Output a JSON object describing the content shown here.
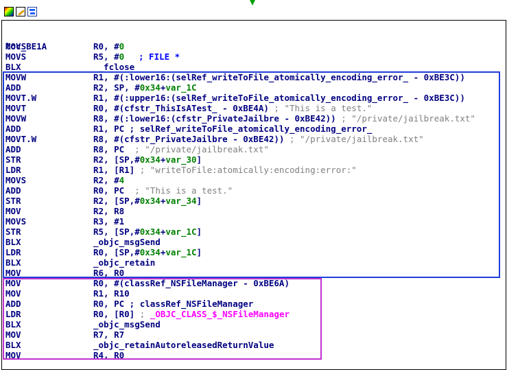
{
  "toolbar": {
    "icons": [
      "color-palette-icon",
      "edit-icon",
      "graph-view-icon"
    ]
  },
  "block": {
    "label": "loc_BE1A",
    "label_comment": "; FILE *"
  },
  "lines": [
    {
      "mnemonic": "MOVS",
      "ops": [
        {
          "t": "R0, #"
        },
        {
          "t": "0",
          "c": "grn"
        }
      ]
    },
    {
      "mnemonic": "MOVS",
      "ops": [
        {
          "t": "R5, #"
        },
        {
          "t": "0",
          "c": "grn"
        }
      ]
    },
    {
      "mnemonic": "BLX",
      "ops": [
        {
          "t": " _fclose"
        }
      ]
    },
    {
      "mnemonic": "MOVW",
      "ops": [
        {
          "t": "R1, #(:lower16:(selRef_writeToFile_atomically_encoding_error_ - 0xBE3C))"
        }
      ]
    },
    {
      "mnemonic": "ADD",
      "ops": [
        {
          "t": "R2, SP, #"
        },
        {
          "t": "0x34",
          "c": "grn"
        },
        {
          "t": "+"
        },
        {
          "t": "var_1C",
          "c": "grn"
        }
      ]
    },
    {
      "mnemonic": "MOVT.W",
      "ops": [
        {
          "t": "R1, #(:upper16:(selRef_writeToFile_atomically_encoding_error_ - 0xBE3C))"
        }
      ]
    },
    {
      "mnemonic": "MOVT",
      "ops": [
        {
          "t": "R0, #(cfstr_ThisIsATest_ - 0xBE4A) "
        },
        {
          "t": "; \"This is a test.\"",
          "c": "gry"
        }
      ]
    },
    {
      "mnemonic": "MOVW",
      "ops": [
        {
          "t": "R8, #(:lower16:(cfstr_PrivateJailbre - 0xBE42)) "
        },
        {
          "t": "; \"/private/jailbreak.txt\"",
          "c": "gry"
        }
      ]
    },
    {
      "mnemonic": "ADD",
      "ops": [
        {
          "t": "R1, PC ; selRef_writeToFile_atomically_encoding_error_"
        }
      ]
    },
    {
      "mnemonic": "MOVT.W",
      "ops": [
        {
          "t": "R8, #(cfstr_PrivateJailbre - 0xBE42)) "
        },
        {
          "t": "; \"/private/jailbreak.txt\"",
          "c": "gry"
        }
      ]
    },
    {
      "mnemonic": "ADD",
      "ops": [
        {
          "t": "R8, PC  "
        },
        {
          "t": "; \"/private/jailbreak.txt\"",
          "c": "gry"
        }
      ]
    },
    {
      "mnemonic": "STR",
      "ops": [
        {
          "t": "R2, [SP,#"
        },
        {
          "t": "0x34",
          "c": "grn"
        },
        {
          "t": "+"
        },
        {
          "t": "var_30",
          "c": "grn"
        },
        {
          "t": "]"
        }
      ]
    },
    {
      "mnemonic": "LDR",
      "ops": [
        {
          "t": "R1, [R1] "
        },
        {
          "t": "; \"writeToFile:atomically:encoding:error:\"",
          "c": "gry"
        }
      ]
    },
    {
      "mnemonic": "MOVS",
      "ops": [
        {
          "t": "R2, #"
        },
        {
          "t": "4",
          "c": "grn"
        }
      ]
    },
    {
      "mnemonic": "ADD",
      "ops": [
        {
          "t": "R0, PC  "
        },
        {
          "t": "; \"This is a test.\"",
          "c": "gry"
        }
      ]
    },
    {
      "mnemonic": "STR",
      "ops": [
        {
          "t": "R2, [SP,#"
        },
        {
          "t": "0x34",
          "c": "grn"
        },
        {
          "t": "+"
        },
        {
          "t": "var_34",
          "c": "grn"
        },
        {
          "t": "]"
        }
      ]
    },
    {
      "mnemonic": "MOV",
      "ops": [
        {
          "t": "R2, R8"
        }
      ]
    },
    {
      "mnemonic": "MOVS",
      "ops": [
        {
          "t": "R3, #1"
        }
      ]
    },
    {
      "mnemonic": "STR",
      "ops": [
        {
          "t": "R5, [SP,#"
        },
        {
          "t": "0x34",
          "c": "grn"
        },
        {
          "t": "+"
        },
        {
          "t": "var_1C",
          "c": "grn"
        },
        {
          "t": "]"
        }
      ]
    },
    {
      "mnemonic": "BLX",
      "ops": [
        {
          "t": "_objc_msgSend"
        }
      ]
    },
    {
      "mnemonic": "LDR",
      "ops": [
        {
          "t": "R0, [SP,#"
        },
        {
          "t": "0x34",
          "c": "grn"
        },
        {
          "t": "+"
        },
        {
          "t": "var_1C",
          "c": "grn"
        },
        {
          "t": "]"
        }
      ]
    },
    {
      "mnemonic": "BLX",
      "ops": [
        {
          "t": "_objc_retain"
        }
      ]
    },
    {
      "mnemonic": "MOV",
      "ops": [
        {
          "t": "R6, R0"
        }
      ]
    },
    {
      "mnemonic": "MOV",
      "ops": [
        {
          "t": "R0, #(classRef_NSFileManager - 0xBE6A)"
        }
      ]
    },
    {
      "mnemonic": "MOV",
      "ops": [
        {
          "t": "R1, R10"
        }
      ]
    },
    {
      "mnemonic": "ADD",
      "ops": [
        {
          "t": "R0, PC ; classRef_NSFileManager"
        }
      ]
    },
    {
      "mnemonic": "LDR",
      "ops": [
        {
          "t": "R0, [R0] "
        },
        {
          "t": "; ",
          "c": "gry"
        },
        {
          "t": "_OBJC_CLASS_$_NSFileManager",
          "c": "mag"
        }
      ]
    },
    {
      "mnemonic": "BLX",
      "ops": [
        {
          "t": "_objc_msgSend"
        }
      ]
    },
    {
      "mnemonic": "MOV",
      "ops": [
        {
          "t": "R7, R7"
        }
      ]
    },
    {
      "mnemonic": "BLX",
      "ops": [
        {
          "t": "_objc_retainAutoreleasedReturnValue"
        }
      ]
    },
    {
      "mnemonic": "MOV",
      "ops": [
        {
          "t": "R4, R0"
        }
      ]
    }
  ],
  "colors": {
    "mnemonic": "#000080",
    "number": "#008000",
    "comment": "#808080",
    "import": "#ff00ff",
    "highlight_blue": "#1f3fd8",
    "highlight_purple": "#c030d0",
    "flow_arrow": "#00a000"
  }
}
